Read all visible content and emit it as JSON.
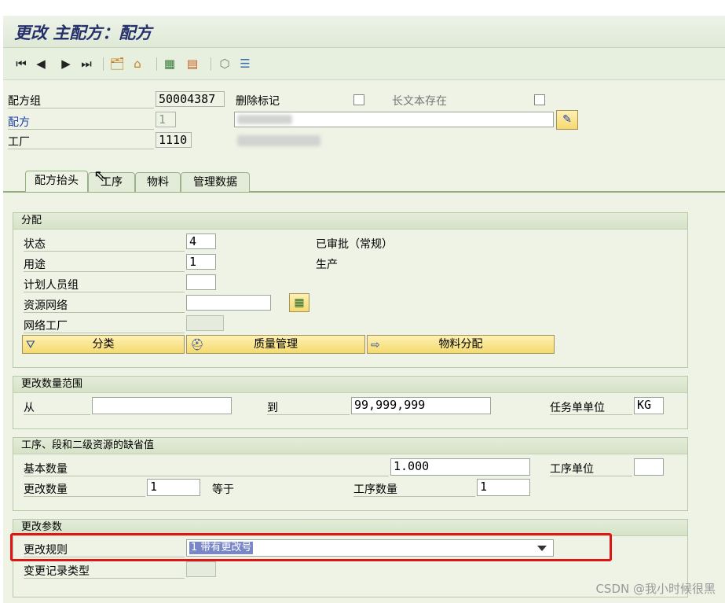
{
  "window": {
    "title": "更改 主配方：配方"
  },
  "toolbar": {
    "icons": [
      "first-page-icon",
      "prev-page-icon",
      "next-page-icon",
      "last-page-icon",
      "new-item-icon",
      "tree-icon",
      "network-icon",
      "calendar-icon",
      "cube-icon",
      "hierarchy-icon"
    ],
    "glyphs": {
      "first": "⏮",
      "prev": "◀",
      "next": "▶",
      "last": "⏭",
      "new_item": "🗂",
      "tree": "⌂",
      "network": "▦",
      "calendar": "▤",
      "cube": "⬡",
      "hierarchy": "☰"
    }
  },
  "header": {
    "recipe_group_label": "配方组",
    "recipe_group_value": "50004387",
    "delete_flag_label": "删除标记",
    "long_text_label": "长文本存在",
    "recipe_label": "配方",
    "recipe_value": "1",
    "plant_label": "工厂",
    "plant_value": "1110",
    "edit_glyph": "✎"
  },
  "tabs": [
    {
      "label": "配方抬头",
      "active": true
    },
    {
      "label": "工序",
      "active": false
    },
    {
      "label": "物料",
      "active": false
    },
    {
      "label": "管理数据",
      "active": false
    }
  ],
  "assignment": {
    "title": "分配",
    "status_label": "状态",
    "status_value": "4",
    "status_text": "已审批（常规）",
    "usage_label": "用途",
    "usage_value": "1",
    "usage_text": "生产",
    "planner_group_label": "计划人员组",
    "planner_group_value": "",
    "resource_network_label": "资源网络",
    "resource_network_value": "",
    "network_plant_label": "网络工厂",
    "network_plant_value": "",
    "network_glyph": "▦",
    "btn_classify": "分类",
    "btn_quality": "质量管理",
    "btn_material_assign": "物料分配",
    "btn_glyphs": {
      "classify": "⛛",
      "quality": "⛑",
      "material": "⇨"
    }
  },
  "qty_range": {
    "title": "更改数量范围",
    "from_label": "从",
    "from_value": "",
    "to_label": "到",
    "to_value": "99,999,999",
    "task_unit_label": "任务单单位",
    "task_unit_value": "KG"
  },
  "defaults": {
    "title": "工序、段和二级资源的缺省值",
    "base_qty_label": "基本数量",
    "base_qty_value": "1.000",
    "op_unit_label": "工序单位",
    "op_unit_value": "",
    "change_qty_label": "更改数量",
    "change_qty_value": "1",
    "equals_label": "等于",
    "op_qty_label": "工序数量",
    "op_qty_value": "1"
  },
  "change_params": {
    "title": "更改参数",
    "rule_label": "更改规则",
    "rule_value": "1 带有更改号",
    "record_type_label": "变更记录类型",
    "record_type_value": ""
  },
  "watermark": "CSDN @我小时候很黑",
  "colors": {
    "highlight_border": "#e01414",
    "link_blue": "#1e3fa8",
    "title_blue": "#25306b",
    "button_yellow": "#f5da6f"
  }
}
